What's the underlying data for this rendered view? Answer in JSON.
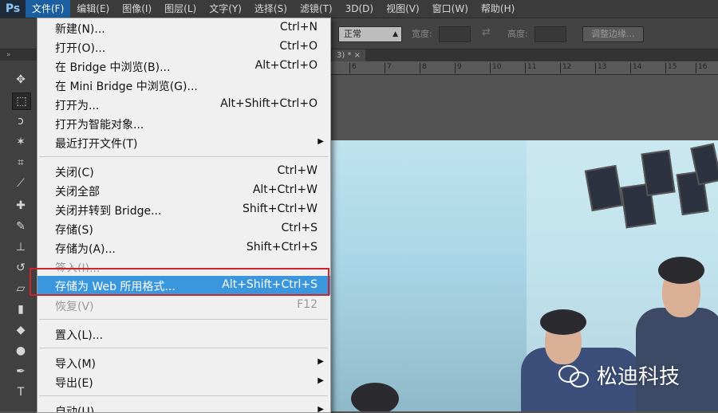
{
  "app": {
    "logo": "Ps"
  },
  "menubar": {
    "items": [
      "文件(F)",
      "编辑(E)",
      "图像(I)",
      "图层(L)",
      "文字(Y)",
      "选择(S)",
      "滤镜(T)",
      "3D(D)",
      "视图(V)",
      "窗口(W)",
      "帮助(H)"
    ],
    "active": "文件(F)"
  },
  "options": {
    "style_value": "正常",
    "width_label": "宽度:",
    "height_label": "高度:",
    "refine_edge_label": "调整边缘..."
  },
  "document": {
    "tab_label": "3) * ×",
    "ruler_ticks": [
      "6",
      "7",
      "8",
      "9",
      "10",
      "11",
      "12",
      "13",
      "14",
      "15",
      "16"
    ]
  },
  "file_menu": {
    "items": [
      {
        "label": "新建(N)...",
        "shortcut": "Ctrl+N"
      },
      {
        "label": "打开(O)...",
        "shortcut": "Ctrl+O"
      },
      {
        "label": "在 Bridge 中浏览(B)...",
        "shortcut": "Alt+Ctrl+O"
      },
      {
        "label": "在 Mini Bridge 中浏览(G)...",
        "shortcut": ""
      },
      {
        "label": "打开为...",
        "shortcut": "Alt+Shift+Ctrl+O"
      },
      {
        "label": "打开为智能对象...",
        "shortcut": ""
      },
      {
        "label": "最近打开文件(T)",
        "shortcut": "",
        "submenu": "▶"
      },
      {
        "label": "关闭(C)",
        "shortcut": "Ctrl+W"
      },
      {
        "label": "关闭全部",
        "shortcut": "Alt+Ctrl+W"
      },
      {
        "label": "关闭并转到 Bridge...",
        "shortcut": "Shift+Ctrl+W"
      },
      {
        "label": "存储(S)",
        "shortcut": "Ctrl+S"
      },
      {
        "label": "存储为(A)...",
        "shortcut": "Shift+Ctrl+S"
      },
      {
        "label": "签入(I)...",
        "shortcut": "",
        "disabled": true
      },
      {
        "label": "存储为 Web 所用格式...",
        "shortcut": "Alt+Shift+Ctrl+S",
        "highlighted": true
      },
      {
        "label": "恢复(V)",
        "shortcut": "F12",
        "disabled": true
      },
      {
        "label": "置入(L)...",
        "shortcut": ""
      },
      {
        "label": "导入(M)",
        "shortcut": "",
        "submenu": "▶"
      },
      {
        "label": "导出(E)",
        "shortcut": "",
        "submenu": "▶"
      },
      {
        "label": "自动(U)",
        "shortcut": "",
        "submenu": "▶"
      }
    ]
  },
  "watermark": {
    "text": "松迪科技"
  },
  "colors": {
    "highlight": "#3a96dd",
    "annotation_box": "#d0222a",
    "menu_bg": "#f0f0f0"
  }
}
